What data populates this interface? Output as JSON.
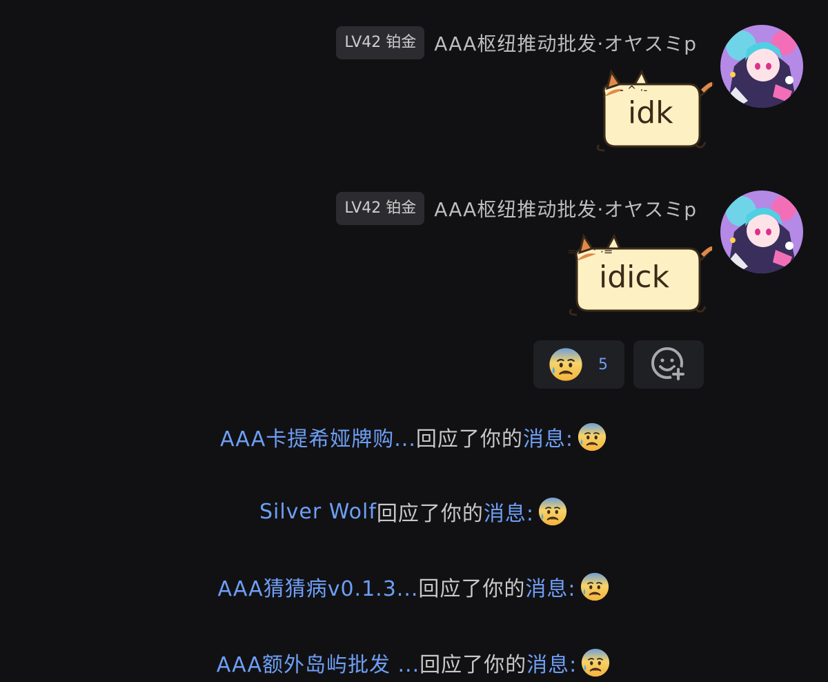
{
  "messages": [
    {
      "level_badge": "LV42 铂金",
      "sender": "AAA枢纽推动批发·オヤスミp",
      "sticker_text": "idk",
      "avatar": "anime-avatar"
    },
    {
      "level_badge": "LV42 铂金",
      "sender": "AAA枢纽推动批发·オヤスミp",
      "sticker_text": "idick",
      "avatar": "anime-avatar"
    }
  ],
  "reactions": {
    "emoji": "anxious-sweat-face",
    "count": "5",
    "add_icon": "add-reaction-icon"
  },
  "notifications": [
    {
      "who": "AAA卡提希娅牌购...",
      "mid": "回应了你的",
      "tail": "消息:",
      "emoji": "anxious-sweat-face"
    },
    {
      "who": "Silver Wolf",
      "mid": "回应了你的",
      "tail": "消息:",
      "emoji": "anxious-sweat-face"
    },
    {
      "who": "AAA猜猜病v0.1.3...",
      "mid": "回应了你的",
      "tail": "消息:",
      "emoji": "anxious-sweat-face"
    },
    {
      "who": "AAA额外岛屿批发 ...",
      "mid": "回应了你的",
      "tail": "消息:",
      "emoji": "anxious-sweat-face"
    }
  ],
  "colors": {
    "background": "#111114",
    "link_blue": "#6e9ff5",
    "badge_bg": "#2c2c30",
    "sticker_fill": "#fdf1c4"
  }
}
